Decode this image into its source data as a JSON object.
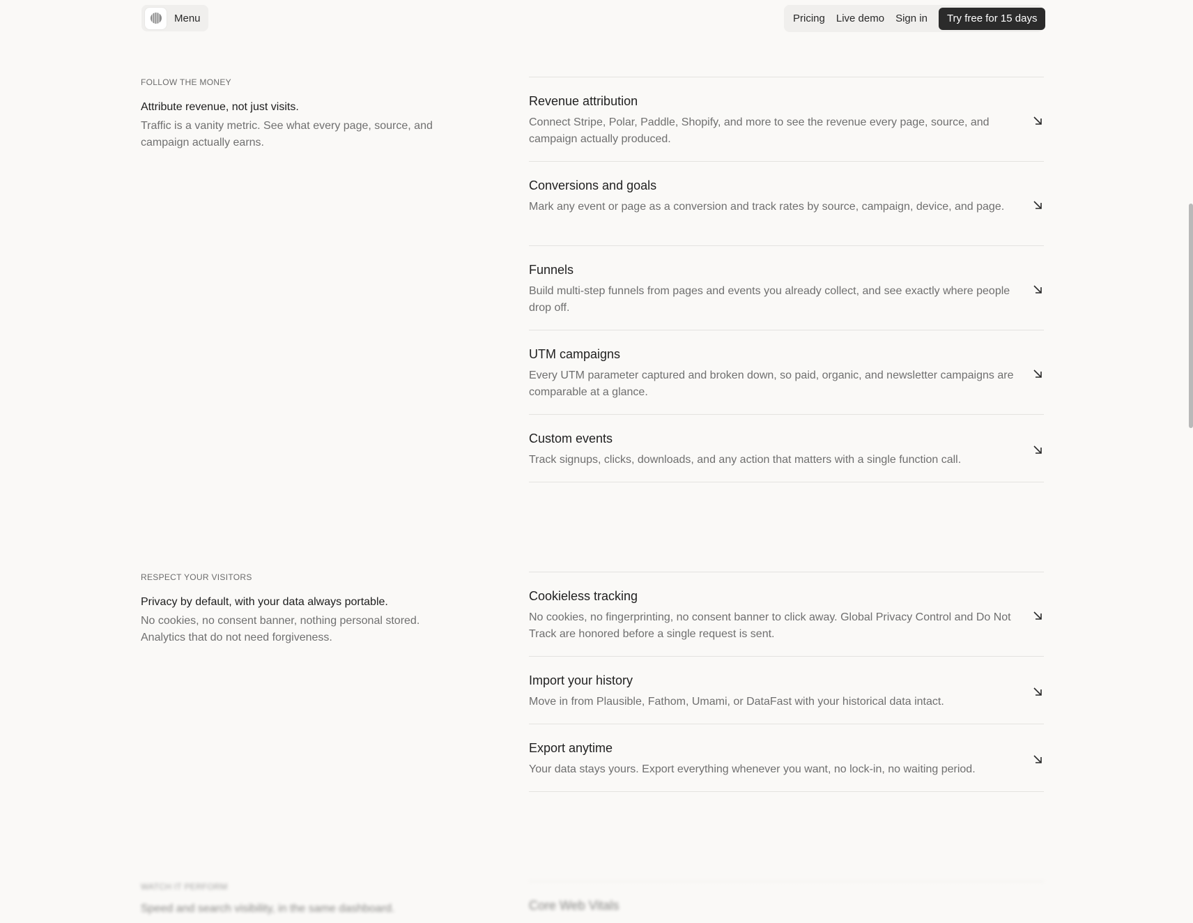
{
  "header": {
    "menu_label": "Menu",
    "logo_icon": "globe-lines-icon",
    "nav": {
      "pricing": "Pricing",
      "live_demo": "Live demo",
      "sign_in": "Sign in",
      "cta": "Try free for 15 days"
    }
  },
  "sections": [
    {
      "eyebrow": "FOLLOW THE MONEY",
      "heading": "Attribute revenue, not just visits.",
      "description": "Traffic is a vanity metric. See what every page, source, and campaign actually earns.",
      "features": [
        {
          "title": "Revenue attribution",
          "description": "Connect Stripe, Polar, Paddle, Shopify, and more to see the revenue every page, source, and campaign actually produced."
        },
        {
          "title": "Conversions and goals",
          "description": "Mark any event or page as a conversion and track rates by source, campaign, device, and page."
        },
        {
          "title": "Funnels",
          "description": "Build multi-step funnels from pages and events you already collect, and see exactly where people drop off."
        },
        {
          "title": "UTM campaigns",
          "description": "Every UTM parameter captured and broken down, so paid, organic, and newsletter campaigns are comparable at a glance."
        },
        {
          "title": "Custom events",
          "description": "Track signups, clicks, downloads, and any action that matters with a single function call."
        }
      ]
    },
    {
      "eyebrow": "RESPECT YOUR VISITORS",
      "heading": "Privacy by default, with your data always portable.",
      "description": "No cookies, no consent banner, nothing personal stored. Analytics that do not need forgiveness.",
      "features": [
        {
          "title": "Cookieless tracking",
          "description": "No cookies, no fingerprinting, no consent banner to click away. Global Privacy Control and Do Not Track are honored before a single request is sent."
        },
        {
          "title": "Import your history",
          "description": "Move in from Plausible, Fathom, Umami, or DataFast with your historical data intact."
        },
        {
          "title": "Export anytime",
          "description": "Your data stays yours. Export everything whenever you want, no lock-in, no waiting period."
        }
      ]
    },
    {
      "eyebrow": "WATCH IT PERFORM",
      "heading": "Speed and search visibility, in the same dashboard.",
      "features": [
        {
          "title": "Core Web Vitals"
        }
      ]
    }
  ],
  "colors": {
    "background": "#faf9f7",
    "pill": "#f0efed",
    "cta": "#2b2b2b",
    "divider": "#e4e3e0"
  },
  "feature_arrow_icon": "arrow-down-right-icon"
}
